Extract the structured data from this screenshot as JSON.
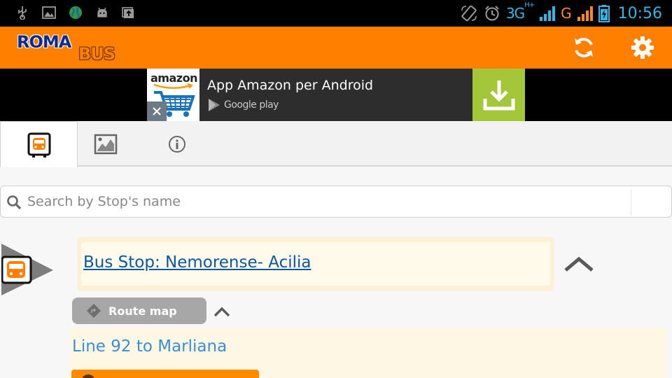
{
  "status_bar": {
    "network_label": "3G",
    "network_sub": "H+",
    "carrier_label": "G",
    "time": "10:56",
    "icons": [
      "usb-icon",
      "image-icon",
      "globe-icon",
      "android-icon",
      "photo-upload-icon",
      "screen-rotate-icon",
      "alarm-icon",
      "signal-icon",
      "battery-charging-icon"
    ]
  },
  "app_bar": {
    "logo_line1": "ROMA",
    "logo_line2": "BUS",
    "actions": [
      "refresh-icon",
      "settings-icon"
    ]
  },
  "ad": {
    "brand": "amazon",
    "title": "App Amazon per Android",
    "store": "Google play",
    "colors": {
      "download_bg": "#a4c639",
      "ad_bg": "#2d2d2d"
    }
  },
  "tabs": [
    {
      "icon": "bus-stop-icon",
      "active": true
    },
    {
      "icon": "map-icon",
      "active": false
    },
    {
      "icon": "info-icon",
      "active": false
    }
  ],
  "search": {
    "placeholder": "Search by Stop's name",
    "value": ""
  },
  "stop": {
    "title": "Bus Stop: Nemorense- Acilia",
    "route_map_label": "Route map",
    "line_title": "Line 92 to Marliana"
  },
  "colors": {
    "accent": "#ff7f00",
    "link": "#0b57a0",
    "line_title": "#3a8fd6",
    "status_blue": "#33b5e5"
  }
}
